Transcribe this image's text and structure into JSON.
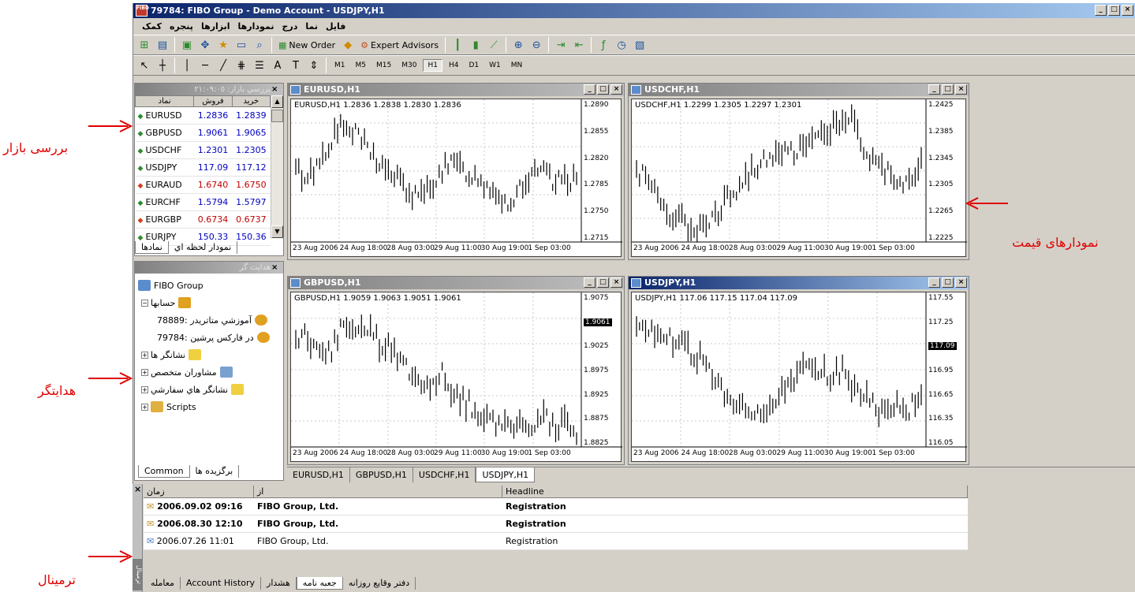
{
  "window": {
    "title": "79784: FIBO Group - Demo Account - USDJPY,H1",
    "app_logo_text": "FIBO"
  },
  "menu": [
    "فایل",
    "نما",
    "درج",
    "نمودارها",
    "ابزارها",
    "پنجره",
    "کمک"
  ],
  "toolbar": {
    "new_order": "New Order",
    "expert_advisors": "Expert Advisors",
    "timeframes": [
      "M1",
      "M5",
      "M15",
      "M30",
      "H1",
      "H4",
      "D1",
      "W1",
      "MN"
    ],
    "active_tf": "H1"
  },
  "market_watch": {
    "title": "بررسي بازار: ٢١:٠٩:٠٥",
    "headers": {
      "symbol": "نماد",
      "bid": "فروش",
      "ask": "خريد"
    },
    "rows": [
      {
        "symbol": "EURUSD",
        "bid": "1.2836",
        "ask": "1.2839",
        "dir": "up"
      },
      {
        "symbol": "GBPUSD",
        "bid": "1.9061",
        "ask": "1.9065",
        "dir": "up"
      },
      {
        "symbol": "USDCHF",
        "bid": "1.2301",
        "ask": "1.2305",
        "dir": "up"
      },
      {
        "symbol": "USDJPY",
        "bid": "117.09",
        "ask": "117.12",
        "dir": "up"
      },
      {
        "symbol": "EURAUD",
        "bid": "1.6740",
        "ask": "1.6750",
        "dir": "down"
      },
      {
        "symbol": "EURCHF",
        "bid": "1.5794",
        "ask": "1.5797",
        "dir": "up"
      },
      {
        "symbol": "EURGBP",
        "bid": "0.6734",
        "ask": "0.6737",
        "dir": "down"
      },
      {
        "symbol": "EURJPY",
        "bid": "150.33",
        "ask": "150.36",
        "dir": "up"
      }
    ],
    "tabs": [
      "نمادها",
      "نمودار لحظه اي"
    ]
  },
  "navigator": {
    "title": "هدايت گر",
    "items": [
      "FIBO Group",
      "حسابها",
      "آموزشي متاتريدر :78889",
      "در فارکس پرشين :79784",
      "نشانگر ها",
      "مشاوران متخصص",
      "نشانگر هاي سفارشي",
      "Scripts"
    ],
    "tabs": [
      "Common",
      "برگزيده ها"
    ]
  },
  "charts": [
    {
      "title": "EURUSD,H1",
      "info": "EURUSD,H1  1.2836 1.2838 1.2830 1.2836",
      "price_labels": [
        "1.2890",
        "1.2855",
        "1.2820",
        "1.2785",
        "1.2750",
        "1.2715"
      ],
      "current": "1.2836",
      "xaxis": [
        "23 Aug 2006",
        "24 Aug 18:00",
        "28 Aug 03:00",
        "29 Aug 11:00",
        "30 Aug 19:00",
        "1 Sep 03:00"
      ]
    },
    {
      "title": "USDCHF,H1",
      "info": "USDCHF,H1  1.2299 1.2305 1.2297 1.2301",
      "price_labels": [
        "1.2425",
        "1.2385",
        "1.2345",
        "1.2305",
        "1.2265",
        "1.2225"
      ],
      "current": "1.2301",
      "xaxis": [
        "23 Aug 2006",
        "24 Aug 18:00",
        "28 Aug 03:00",
        "29 Aug 11:00",
        "30 Aug 19:00",
        "1 Sep 03:00"
      ]
    },
    {
      "title": "GBPUSD,H1",
      "info": "GBPUSD,H1  1.9059 1.9063 1.9051 1.9061",
      "price_labels": [
        "1.9075",
        "1.9061",
        "1.9025",
        "1.8975",
        "1.8925",
        "1.8875",
        "1.8825"
      ],
      "current": "1.9061",
      "xaxis": [
        "23 Aug 2006",
        "24 Aug 18:00",
        "28 Aug 03:00",
        "29 Aug 11:00",
        "30 Aug 19:00",
        "1 Sep 03:00"
      ]
    },
    {
      "title": "USDJPY,H1",
      "info": "USDJPY,H1  117.06 117.15 117.04 117.09",
      "price_labels": [
        "117.55",
        "117.25",
        "117.09",
        "116.95",
        "116.65",
        "116.35",
        "116.05"
      ],
      "current": "117.09",
      "xaxis": [
        "23 Aug 2006",
        "24 Aug 18:00",
        "28 Aug 03:00",
        "29 Aug 11:00",
        "30 Aug 19:00",
        "1 Sep 03:00"
      ]
    }
  ],
  "chart_tabs": [
    "EURUSD,H1",
    "GBPUSD,H1",
    "USDCHF,H1",
    "USDJPY,H1"
  ],
  "active_chart_tab": "USDJPY,H1",
  "terminal": {
    "side_label": "ترمینال",
    "headers": {
      "time": "زمان",
      "from": "از",
      "headline": "Headline"
    },
    "rows": [
      {
        "time": "2006.09.02 09:16",
        "from": "FIBO Group, Ltd.",
        "headline": "Registration",
        "bold": true
      },
      {
        "time": "2006.08.30 12:10",
        "from": "FIBO Group, Ltd.",
        "headline": "Registration",
        "bold": true
      },
      {
        "time": "2006.07.26 11:01",
        "from": "FIBO Group, Ltd.",
        "headline": "Registration",
        "bold": false
      }
    ],
    "tabs": [
      "دفتر وقايع روزانه",
      "جعبه نامه",
      "هشدار",
      "Account History",
      "معامله"
    ],
    "active_tab": "جعبه نامه"
  },
  "annotations": {
    "market_watch": "بررسی بازار",
    "charts": "نمودارهای  قیمت",
    "navigator": "هدایتگر",
    "terminal": "ترمینال"
  },
  "colors": {
    "annotation": "#e00000",
    "title_active": "#0a246a",
    "bid_up": "#0000c0",
    "bid_down": "#c00000"
  }
}
